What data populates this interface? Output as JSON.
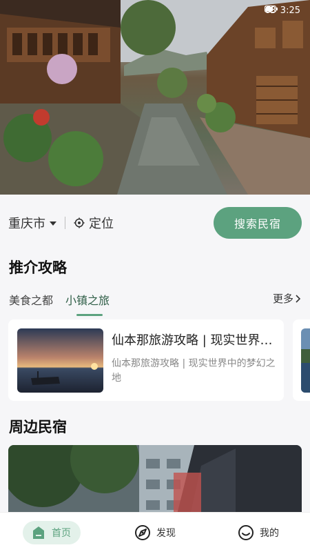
{
  "status": {
    "battery": "63",
    "time": "3:25"
  },
  "location": {
    "city": "重庆市",
    "locate_label": "定位"
  },
  "search_button": "搜索民宿",
  "guides": {
    "title": "推介攻略",
    "tabs": [
      "美食之都",
      "小镇之旅"
    ],
    "active_tab": 1,
    "more_label": "更多",
    "cards": [
      {
        "title": "仙本那旅游攻略 | 现实世界中的梦幻之地",
        "desc": "仙本那旅游攻略 | 现实世界中的梦幻之地"
      }
    ]
  },
  "nearby": {
    "title": "周边民宿"
  },
  "bottom_nav": [
    {
      "label": "首页",
      "icon": "home-icon",
      "active": true
    },
    {
      "label": "发现",
      "icon": "compass-icon",
      "active": false
    },
    {
      "label": "我的",
      "icon": "smile-icon",
      "active": false
    }
  ],
  "colors": {
    "accent": "#5ca27f",
    "accent_light": "#e3f1ea"
  }
}
